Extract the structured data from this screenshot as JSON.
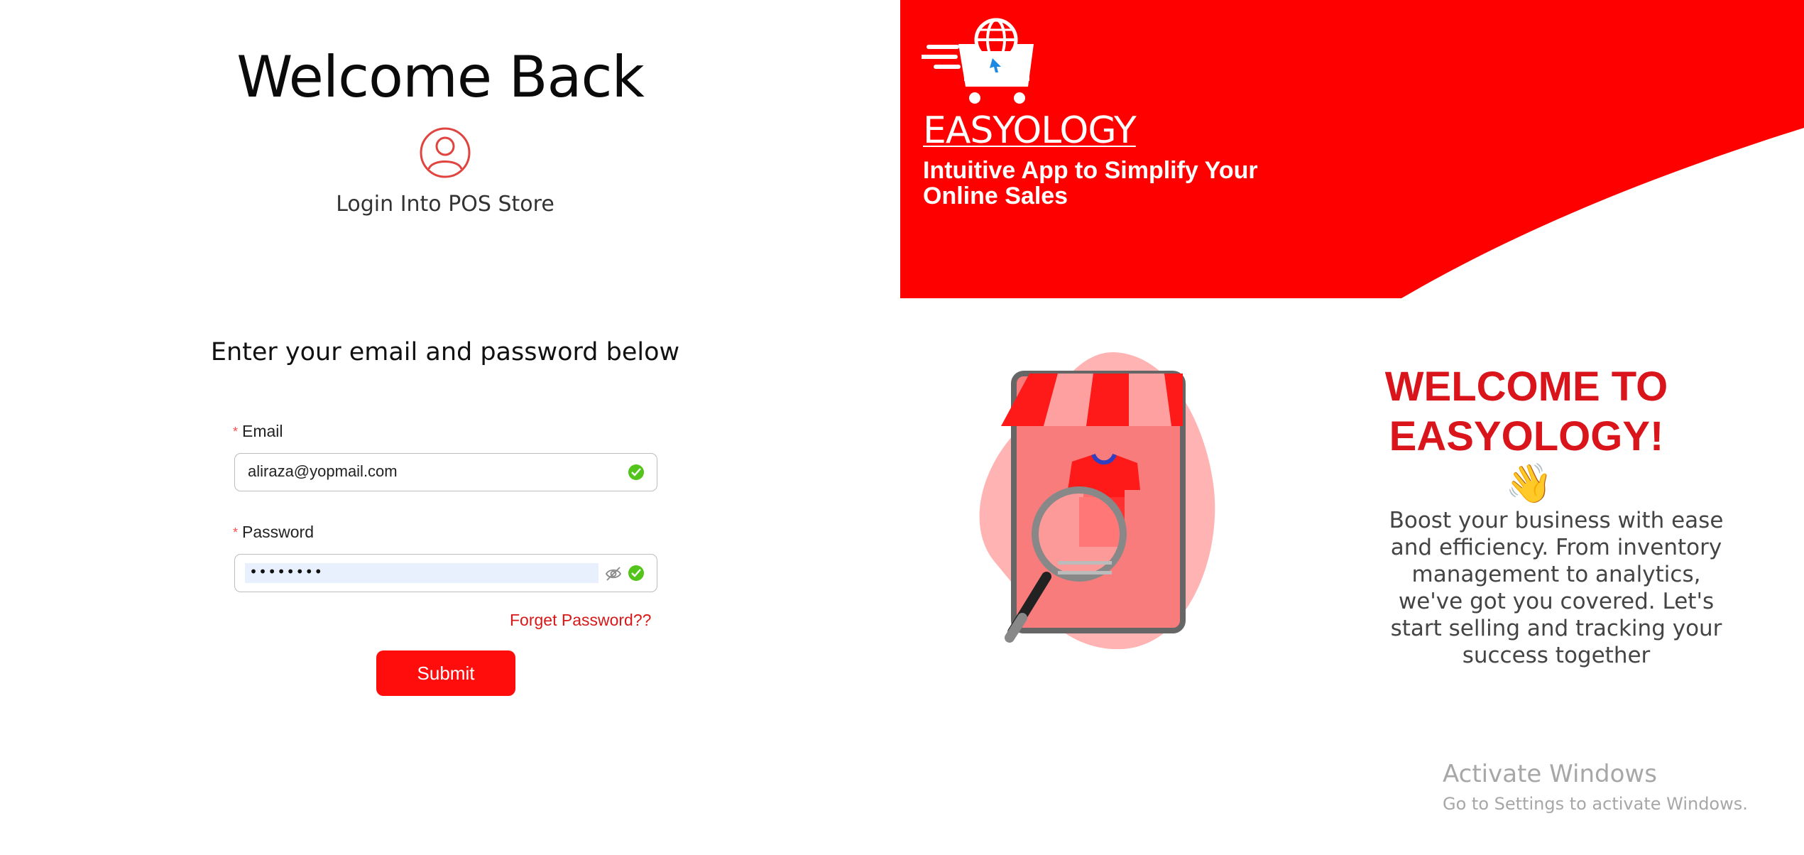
{
  "login": {
    "title": "Welcome Back",
    "subtitle": "Login Into POS Store",
    "instruction": "Enter your email and password below",
    "email_label": "Email",
    "email_value": "aliraza@yopmail.com",
    "password_label": "Password",
    "password_value": "••••••••",
    "required_mark": "*",
    "forget_label": "Forget Password??",
    "submit_label": "Submit"
  },
  "banner": {
    "brand": "EASYOLOGY",
    "tagline_line1": "Intuitive App to Simplify Your",
    "tagline_line2": "Online Sales"
  },
  "welcome": {
    "title_line1": "WELCOME TO",
    "title_line2": "EASYOLOGY!",
    "emoji": "👋",
    "description": "Boost your business with ease and efficiency. From inventory management to analytics, we've got you covered. Let's start selling and tracking your success together"
  },
  "watermark": {
    "line1": "Activate Windows",
    "line2": "Go to Settings to activate Windows."
  },
  "colors": {
    "accent": "#ff0000",
    "title_red": "#d9141b",
    "success": "#52c41a"
  },
  "icons": [
    "user-circle-icon",
    "check-circle-icon",
    "eye-off-icon",
    "cart-globe-logo-icon",
    "store-phone-illustration",
    "waving-hand-icon"
  ]
}
